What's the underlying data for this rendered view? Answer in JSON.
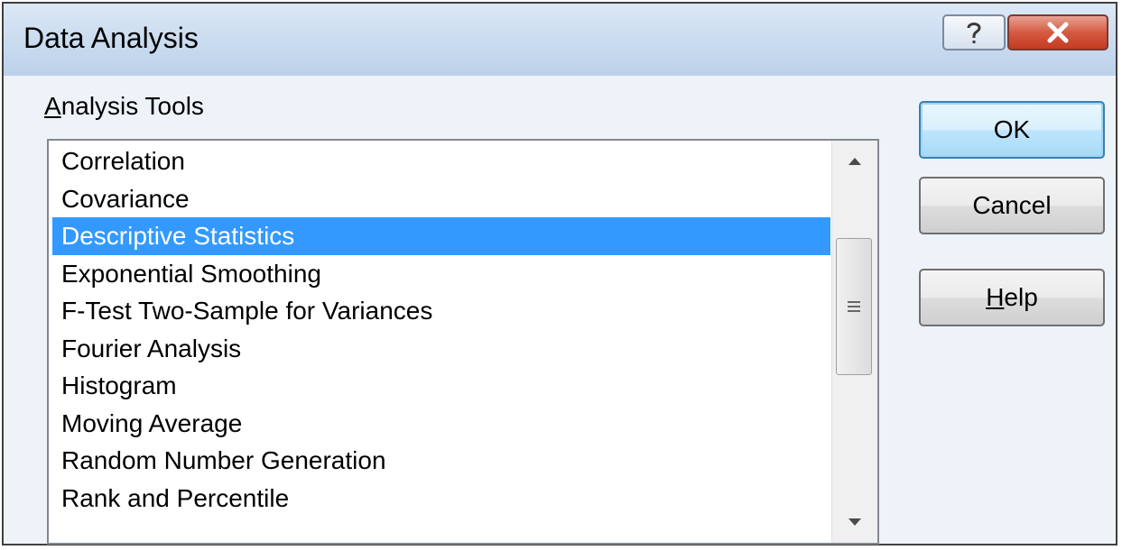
{
  "window": {
    "title": "Data Analysis"
  },
  "titlebar": {
    "help_icon": "question-mark-icon",
    "close_icon": "close-x-icon"
  },
  "analysis_tools": {
    "label_first": "A",
    "label_rest": "nalysis Tools",
    "items": [
      "Correlation",
      "Covariance",
      "Descriptive Statistics",
      "Exponential Smoothing",
      "F-Test Two-Sample for Variances",
      "Fourier Analysis",
      "Histogram",
      "Moving Average",
      "Random Number Generation",
      "Rank and Percentile"
    ],
    "selected_index": 2
  },
  "buttons": {
    "ok": "OK",
    "cancel": "Cancel",
    "help_first": "H",
    "help_rest": "elp"
  },
  "colors": {
    "selection": "#3399ff",
    "close_button": "#c43b22",
    "default_button_border": "#3c7fb1"
  }
}
